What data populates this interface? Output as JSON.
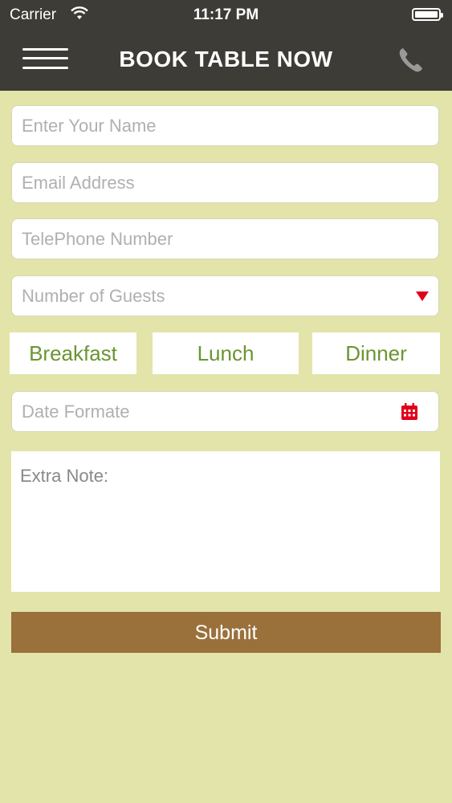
{
  "status_bar": {
    "carrier": "Carrier",
    "time": "11:17 PM"
  },
  "header": {
    "title": "BOOK TABLE NOW",
    "menu_icon": "hamburger-menu-icon",
    "phone_icon": "phone-icon"
  },
  "form": {
    "name_placeholder": "Enter Your Name",
    "email_placeholder": "Email Address",
    "phone_placeholder": "TelePhone Number",
    "guests_placeholder": "Number of Guests",
    "meals": [
      "Breakfast",
      "Lunch",
      "Dinner"
    ],
    "date_placeholder": "Date Formate",
    "note_placeholder": "Extra Note:",
    "submit_label": "Submit"
  },
  "colors": {
    "background": "#e3e4a9",
    "header": "#3e3c37",
    "meal_text": "#6b9530",
    "submit": "#9a703b",
    "accent_red": "#e0001a"
  }
}
